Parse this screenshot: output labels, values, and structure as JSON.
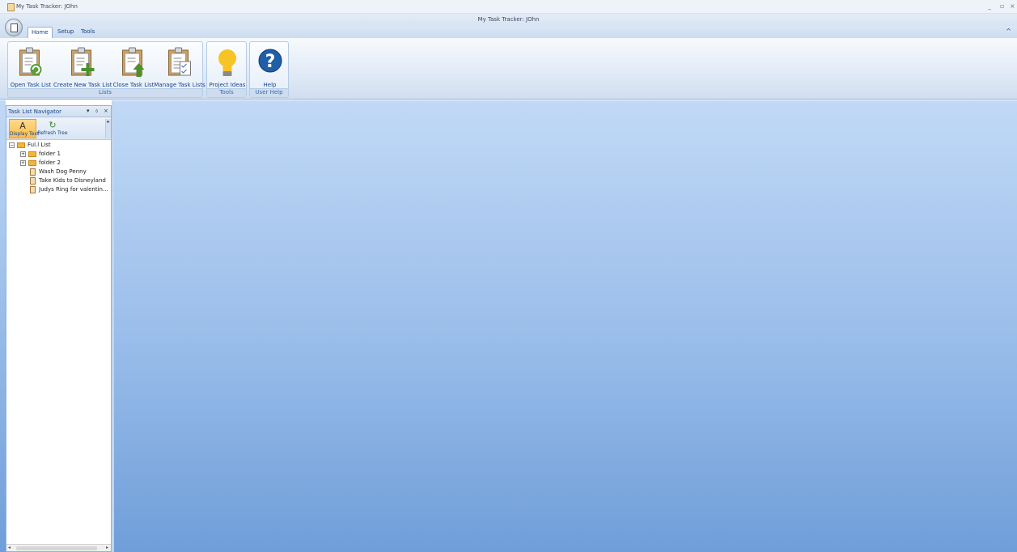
{
  "window": {
    "title": "My Task Tracker: JOhn",
    "caption": "My Task Tracker: JOhn",
    "minimize": "_",
    "maximize": "▫",
    "close": "×"
  },
  "ribbon": {
    "tabs": [
      {
        "label": "Home",
        "active": true
      },
      {
        "label": "Setup",
        "active": false
      },
      {
        "label": "Tools",
        "active": false
      }
    ],
    "collapse_glyph": "^",
    "groups": {
      "lists": {
        "label": "Lists",
        "buttons": [
          {
            "label": "Open Task List",
            "icon": "open-task-list-icon"
          },
          {
            "label": "Create New Task List",
            "icon": "create-task-list-icon"
          },
          {
            "label": "Close Task List",
            "icon": "close-task-list-icon"
          },
          {
            "label": "Manage Task Lists",
            "icon": "manage-task-lists-icon"
          }
        ]
      },
      "tools": {
        "label": "Tools",
        "buttons": [
          {
            "label": "Project Ideas",
            "icon": "lightbulb-icon"
          }
        ]
      },
      "user_help": {
        "label": "User Help",
        "buttons": [
          {
            "label": "Help",
            "icon": "help-icon",
            "glyph": "?"
          }
        ]
      }
    }
  },
  "navigator": {
    "title": "Task List Navigator",
    "controls": {
      "dropdown": "▾",
      "pin": "⬨",
      "close": "×"
    },
    "toolbar": [
      {
        "label": "Display Text",
        "glyph": "A",
        "active": true
      },
      {
        "label": "Refresh Tree",
        "glyph": "↻",
        "active": false
      }
    ],
    "tree": {
      "root": {
        "label": "Ful.l List",
        "expanded": true,
        "toggle": "−"
      },
      "folders": [
        {
          "label": "folder 1",
          "toggle": "+"
        },
        {
          "label": "folder 2",
          "toggle": "+"
        }
      ],
      "tasks": [
        {
          "label": "Wash Dog Penny"
        },
        {
          "label": "Take Kids to Disneyland"
        },
        {
          "label": "Judys Ring for valentin..."
        }
      ]
    }
  },
  "colors": {
    "ribbon_text": "#15428b",
    "workspace_top": "#c1d9f6",
    "workspace_bottom": "#6f9ed9",
    "active_button": "#fbbd4a",
    "help_circle": "#1f5fa8",
    "lightbulb": "#f7c325"
  }
}
